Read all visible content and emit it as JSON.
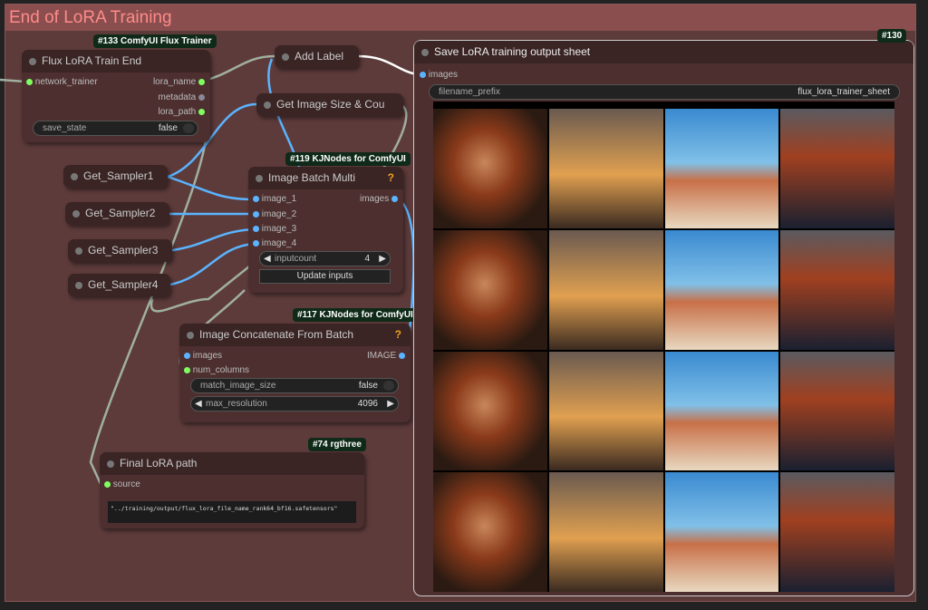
{
  "group": {
    "title": "End of LoRA Training"
  },
  "nodes": {
    "flux_train_end": {
      "badge": "#133 ComfyUI Flux Trainer",
      "title": "Flux LoRA Train End",
      "input": "network_trainer",
      "outputs": [
        "lora_name",
        "metadata",
        "lora_path"
      ],
      "widget": {
        "label": "save_state",
        "value": "false"
      }
    },
    "add_label": {
      "title": "Add Label"
    },
    "get_image_size": {
      "title": "Get Image Size & Cou"
    },
    "samplers": [
      "Get_Sampler1",
      "Get_Sampler2",
      "Get_Sampler3",
      "Get_Sampler4"
    ],
    "image_batch_multi": {
      "badge": "#119 KJNodes for ComfyUI",
      "title": "Image Batch Multi",
      "help": "?",
      "inputs": [
        "image_1",
        "image_2",
        "image_3",
        "image_4"
      ],
      "output": "images",
      "inputcount": {
        "label": "inputcount",
        "value": "4"
      },
      "button": "Update inputs"
    },
    "image_concat": {
      "badge": "#117 KJNodes for ComfyUI",
      "title": "Image Concatenate From Batch",
      "help": "?",
      "inputs": [
        "images",
        "num_columns"
      ],
      "output": "IMAGE",
      "match_image_size": {
        "label": "match_image_size",
        "value": "false"
      },
      "max_resolution": {
        "label": "max_resolution",
        "value": "4096"
      }
    },
    "final_lora_path": {
      "badge": "#74 rgthree",
      "title": "Final LoRA path",
      "input": "source",
      "text": "\"../training/output/flux_lora_file_name_rank64_bf16.safetensors\""
    },
    "save_sheet": {
      "badge": "#130",
      "title": "Save LoRA training output sheet",
      "input": "images",
      "filename_prefix": {
        "label": "filename_prefix",
        "value": "flux_lora_trainer_sheet"
      }
    }
  },
  "colors": {
    "group_bg": "#5e3b3b",
    "group_title": "#ff8a8a",
    "wire_image": "#5ab4ff",
    "wire_other": "#a0b0a0"
  },
  "image_grid": {
    "rows": 4,
    "columns": 4
  }
}
